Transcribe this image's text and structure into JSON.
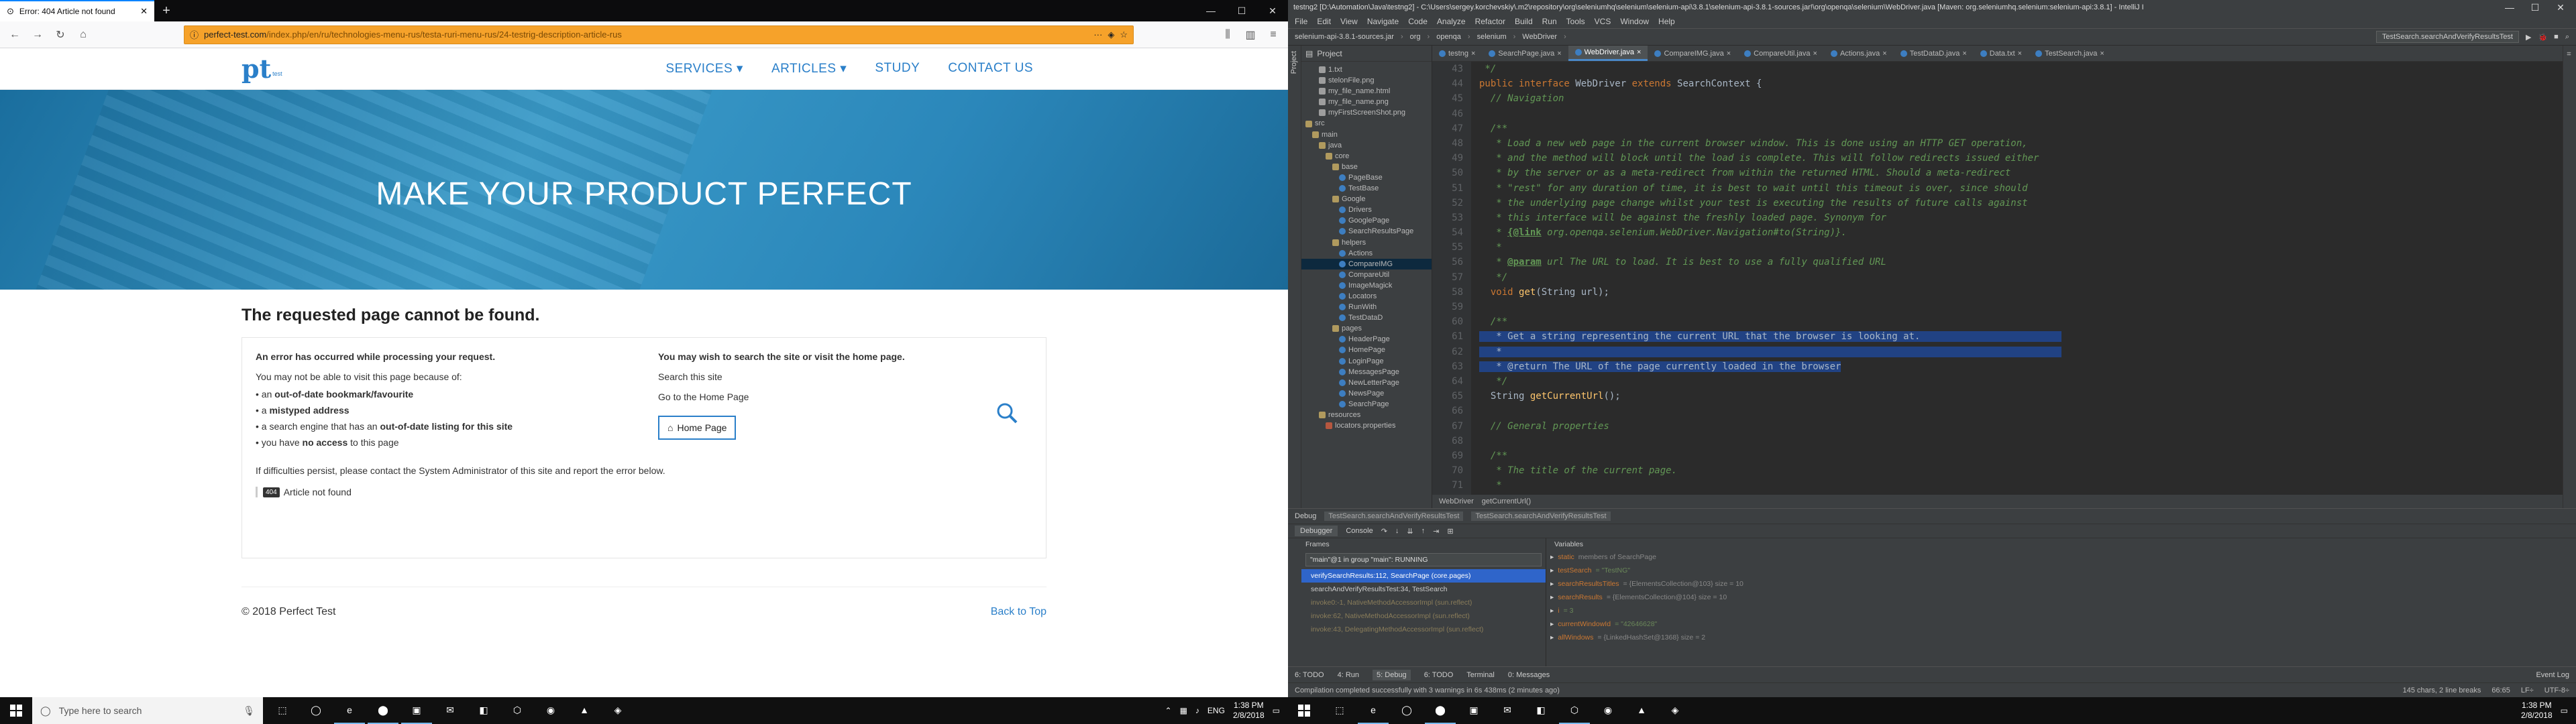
{
  "firefox": {
    "tab_title": "Error: 404 Article not found",
    "url_host": "perfect-test.com",
    "url_path": "/index.php/en/ru/technologies-menu-rus/testa-ruri-menu-rus/24-testrig-description-article-rus",
    "site": {
      "logo_mark": "pt",
      "logo_sub": "test",
      "logo_caption": "PERFECT",
      "menu": [
        "SERVICES ▾",
        "ARTICLES ▾",
        "STUDY",
        "CONTACT US"
      ],
      "hero_title": "MAKE YOUR PRODUCT PERFECT",
      "error_heading": "The requested page cannot be found.",
      "left_col": {
        "heading": "An error has occurred while processing your request.",
        "intro": "You may not be able to visit this page because of:",
        "reasons": [
          {
            "pre": "an ",
            "bold": "out-of-date bookmark/favourite",
            "post": ""
          },
          {
            "pre": "a ",
            "bold": "mistyped address",
            "post": ""
          },
          {
            "pre": "a search engine that has an ",
            "bold": "out-of-date listing for this site",
            "post": ""
          },
          {
            "pre": "you have ",
            "bold": "no access",
            "post": " to this page"
          }
        ]
      },
      "right_col": {
        "heading": "You may wish to search the site or visit the home page.",
        "search_text": "Search this site",
        "home_text": "Go to the Home Page",
        "home_button": "Home Page"
      },
      "persist_text": "If difficulties persist, please contact the System Administrator of this site and report the error below.",
      "error_code": "404",
      "error_msg": "Article not found",
      "copyright": "© 2018 Perfect Test",
      "back_to_top": "Back to Top"
    }
  },
  "intellij": {
    "title": "testng2 [D:\\Automation\\Java\\testng2] - C:\\Users\\sergey.korchevskiy\\.m2\\repository\\org\\seleniumhq\\selenium\\selenium-api\\3.8.1\\selenium-api-3.8.1-sources.jar!\\org\\openqa\\selenium\\WebDriver.java [Maven: org.seleniumhq.selenium:selenium-api:3.8.1] - IntelliJ I",
    "menu": [
      "File",
      "Edit",
      "View",
      "Navigate",
      "Code",
      "Analyze",
      "Refactor",
      "Build",
      "Run",
      "Tools",
      "VCS",
      "Window",
      "Help"
    ],
    "breadcrumbs": [
      "selenium-api-3.8.1-sources.jar",
      "org",
      "openqa",
      "selenium",
      "WebDriver"
    ],
    "run_config": "TestSearch.searchAndVerifyResultsTest",
    "project_label": "Project",
    "tree": [
      {
        "label": "1.txt",
        "icon": "x",
        "d": 2
      },
      {
        "label": "stelonFile.png",
        "icon": "x",
        "d": 2
      },
      {
        "label": "my_file_name.html",
        "icon": "x",
        "d": 2
      },
      {
        "label": "my_file_name.png",
        "icon": "x",
        "d": 2
      },
      {
        "label": "myFirstScreenShot.png",
        "icon": "x",
        "d": 2
      },
      {
        "label": "",
        "icon": "",
        "d": 0
      },
      {
        "label": "src",
        "icon": "f",
        "d": 0
      },
      {
        "label": "main",
        "icon": "f",
        "d": 1
      },
      {
        "label": "java",
        "icon": "f",
        "d": 2
      },
      {
        "label": "core",
        "icon": "f",
        "d": 3
      },
      {
        "label": "base",
        "icon": "f",
        "d": 4
      },
      {
        "label": "PageBase",
        "icon": "c",
        "d": 5
      },
      {
        "label": "TestBase",
        "icon": "c",
        "d": 5
      },
      {
        "label": "Google",
        "icon": "f",
        "d": 4
      },
      {
        "label": "Drivers",
        "icon": "c",
        "d": 5
      },
      {
        "label": "GooglePage",
        "icon": "c",
        "d": 5
      },
      {
        "label": "SearchResultsPage",
        "icon": "c",
        "d": 5
      },
      {
        "label": "helpers",
        "icon": "f",
        "d": 4
      },
      {
        "label": "Actions",
        "icon": "c",
        "d": 5
      },
      {
        "label": "CompareIMG",
        "icon": "c",
        "d": 5,
        "sel": true
      },
      {
        "label": "CompareUtil",
        "icon": "c",
        "d": 5
      },
      {
        "label": "ImageMagick",
        "icon": "c",
        "d": 5
      },
      {
        "label": "Locators",
        "icon": "c",
        "d": 5
      },
      {
        "label": "RunWith",
        "icon": "c",
        "d": 5
      },
      {
        "label": "TestDataD",
        "icon": "c",
        "d": 5
      },
      {
        "label": "pages",
        "icon": "f",
        "d": 4
      },
      {
        "label": "HeaderPage",
        "icon": "c",
        "d": 5
      },
      {
        "label": "HomePage",
        "icon": "c",
        "d": 5
      },
      {
        "label": "LoginPage",
        "icon": "c",
        "d": 5
      },
      {
        "label": "MessagesPage",
        "icon": "c",
        "d": 5
      },
      {
        "label": "NewLetterPage",
        "icon": "c",
        "d": 5
      },
      {
        "label": "NewsPage",
        "icon": "c",
        "d": 5
      },
      {
        "label": "SearchPage",
        "icon": "c",
        "d": 5
      },
      {
        "label": "resources",
        "icon": "f",
        "d": 2
      },
      {
        "label": "locators.properties",
        "icon": "r",
        "d": 3
      }
    ],
    "tabs": [
      {
        "label": "testng",
        "active": false
      },
      {
        "label": "SearchPage.java",
        "active": false
      },
      {
        "label": "WebDriver.java",
        "active": true
      },
      {
        "label": "CompareIMG.java",
        "active": false
      },
      {
        "label": "CompareUtil.java",
        "active": false
      },
      {
        "label": "Actions.java",
        "active": false
      },
      {
        "label": "TestDataD.java",
        "active": false
      },
      {
        "label": "Data.txt",
        "active": false
      },
      {
        "label": "TestSearch.java",
        "active": false
      }
    ],
    "code_lines": [
      {
        "n": "43",
        "segs": [
          {
            "c": "cm",
            "t": " */"
          }
        ]
      },
      {
        "n": "44",
        "segs": [
          {
            "c": "kw",
            "t": "public interface "
          },
          {
            "c": "ty",
            "t": "WebDriver "
          },
          {
            "c": "kw",
            "t": "extends "
          },
          {
            "c": "ty",
            "t": "SearchContext {"
          }
        ]
      },
      {
        "n": "45",
        "segs": [
          {
            "c": "cm",
            "t": "  // Navigation"
          }
        ]
      },
      {
        "n": "46",
        "segs": [
          {
            "c": "",
            "t": ""
          }
        ]
      },
      {
        "n": "47",
        "segs": [
          {
            "c": "cm",
            "t": "  /**"
          }
        ]
      },
      {
        "n": "48",
        "segs": [
          {
            "c": "cm",
            "t": "   * Load a new web page in the current browser window. This is done using an HTTP GET operation,"
          }
        ]
      },
      {
        "n": "49",
        "segs": [
          {
            "c": "cm",
            "t": "   * and the method will block until the load is complete. This will follow redirects issued either"
          }
        ]
      },
      {
        "n": "50",
        "segs": [
          {
            "c": "cm",
            "t": "   * by the server or as a meta-redirect from within the returned HTML. Should a meta-redirect"
          }
        ]
      },
      {
        "n": "51",
        "segs": [
          {
            "c": "cm",
            "t": "   * \"rest\" for any duration of time, it is best to wait until this timeout is over, since should"
          }
        ]
      },
      {
        "n": "52",
        "segs": [
          {
            "c": "cm",
            "t": "   * the underlying page change whilst your test is executing the results of future calls against"
          }
        ]
      },
      {
        "n": "53",
        "segs": [
          {
            "c": "cm",
            "t": "   * this interface will be against the freshly loaded page. Synonym for"
          }
        ]
      },
      {
        "n": "54",
        "segs": [
          {
            "c": "cm",
            "t": "   * "
          },
          {
            "c": "tg",
            "t": "{@link"
          },
          {
            "c": "cm",
            "t": " org.openqa.selenium.WebDriver.Navigation#to(String)}."
          }
        ]
      },
      {
        "n": "55",
        "segs": [
          {
            "c": "cm",
            "t": "   *"
          }
        ]
      },
      {
        "n": "56",
        "segs": [
          {
            "c": "cm",
            "t": "   * "
          },
          {
            "c": "tg",
            "t": "@param"
          },
          {
            "c": "cm",
            "t": " url The URL to load. It is best to use a fully qualified URL"
          }
        ]
      },
      {
        "n": "57",
        "segs": [
          {
            "c": "cm",
            "t": "   */"
          }
        ]
      },
      {
        "n": "58",
        "segs": [
          {
            "c": "ty",
            "t": "  "
          },
          {
            "c": "kw",
            "t": "void "
          },
          {
            "c": "fn",
            "t": "get"
          },
          {
            "c": "ty",
            "t": "(String url);"
          }
        ]
      },
      {
        "n": "59",
        "segs": [
          {
            "c": "",
            "t": ""
          }
        ]
      },
      {
        "n": "60",
        "segs": [
          {
            "c": "cm",
            "t": "  /**"
          }
        ]
      },
      {
        "n": "61",
        "segs": [
          {
            "c": "hl",
            "t": "   * Get a string representing the current URL that the browser is looking at.                         "
          }
        ]
      },
      {
        "n": "62",
        "segs": [
          {
            "c": "hl",
            "t": "   *                                                                                                   "
          }
        ]
      },
      {
        "n": "63",
        "segs": [
          {
            "c": "hl",
            "t": "   * @return The URL of the page currently loaded in the browser"
          }
        ]
      },
      {
        "n": "64",
        "segs": [
          {
            "c": "cm",
            "t": "   */"
          }
        ]
      },
      {
        "n": "65",
        "segs": [
          {
            "c": "ty",
            "t": "  String "
          },
          {
            "c": "fn",
            "t": "getCurrentUrl"
          },
          {
            "c": "ty",
            "t": "();"
          }
        ]
      },
      {
        "n": "66",
        "segs": [
          {
            "c": "",
            "t": ""
          }
        ]
      },
      {
        "n": "67",
        "segs": [
          {
            "c": "cm",
            "t": "  // General properties"
          }
        ]
      },
      {
        "n": "68",
        "segs": [
          {
            "c": "",
            "t": ""
          }
        ]
      },
      {
        "n": "69",
        "segs": [
          {
            "c": "cm",
            "t": "  /**"
          }
        ]
      },
      {
        "n": "70",
        "segs": [
          {
            "c": "cm",
            "t": "   * The title of the current page."
          }
        ]
      },
      {
        "n": "71",
        "segs": [
          {
            "c": "cm",
            "t": "   *"
          }
        ]
      }
    ],
    "editor_crumbs": [
      "WebDriver",
      "getCurrentUrl()"
    ],
    "debug_label": "Debug",
    "debug_sessions": [
      "TestSearch.searchAndVerifyResultsTest",
      "TestSearch.searchAndVerifyResultsTest"
    ],
    "debug_tabs": [
      "Debugger",
      "Console"
    ],
    "frames_label": "Frames",
    "variables_label": "Variables",
    "thread": "\"main\"@1 in group \"main\": RUNNING",
    "frames": [
      {
        "t": "verifySearchResults:112, SearchPage (core.pages)",
        "sel": true,
        "lib": false
      },
      {
        "t": "searchAndVerifyResultsTest:34, TestSearch",
        "sel": false,
        "lib": false
      },
      {
        "t": "invoke0:-1, NativeMethodAccessorImpl (sun.reflect)",
        "sel": false,
        "lib": true
      },
      {
        "t": "invoke:62, NativeMethodAccessorImpl (sun.reflect)",
        "sel": false,
        "lib": true
      },
      {
        "t": "invoke:43, DelegatingMethodAccessorImpl (sun.reflect)",
        "sel": false,
        "lib": true
      }
    ],
    "vars": [
      {
        "nm": "static",
        "vl": "",
        "dm": "members of SearchPage"
      },
      {
        "nm": "testSearch",
        "vl": "= \"TestNG\"",
        "dm": ""
      },
      {
        "nm": "searchResultsTitles",
        "vl": "",
        "dm": "= {ElementsCollection@103}  size = 10"
      },
      {
        "nm": "searchResults",
        "vl": "",
        "dm": "= {ElementsCollection@104}  size = 10"
      },
      {
        "nm": "i",
        "vl": "= 3",
        "dm": ""
      },
      {
        "nm": "currentWindowId",
        "vl": "= \"42646628\"",
        "dm": ""
      },
      {
        "nm": "allWindows",
        "vl": "",
        "dm": "= {LinkedHashSet@1368}  size = 2"
      }
    ],
    "toolwindows": [
      "6: TODO",
      "4: Run",
      "5: Debug",
      "6: TODO",
      "Terminal",
      "0: Messages"
    ],
    "toolwin_active": 2,
    "event_log": "Event Log",
    "status_msg": "Compilation completed successfully with 3 warnings in 6s 438ms (2 minutes ago)",
    "status_right": [
      "145 chars, 2 line breaks",
      "66:65",
      "LF÷",
      "UTF-8÷"
    ]
  },
  "taskbar_left": {
    "search_placeholder": "Type here to search",
    "apps": [
      "⬚",
      "◯",
      "e",
      "⬤",
      "▣",
      "✉",
      "◧",
      "⬡",
      "◉",
      "▲",
      "◈"
    ],
    "lang": "ENG",
    "time": "1:38 PM",
    "date": "2/8/2018"
  },
  "taskbar_right": {
    "apps": [
      "⬚",
      "e",
      "◯",
      "⬤",
      "▣",
      "✉",
      "◧",
      "⬡",
      "◉",
      "▲",
      "◈"
    ],
    "time": "1:38 PM",
    "date": "2/8/2018"
  },
  "colors": {
    "accent": "#2a7fc9",
    "url_bar": "#f6a22a",
    "ide_bg": "#2b2b2b",
    "ide_sel": "#214283"
  }
}
